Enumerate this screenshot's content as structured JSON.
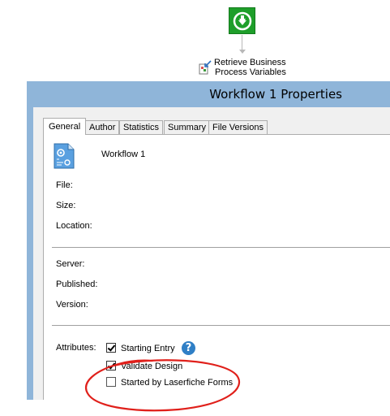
{
  "canvas": {
    "activity_label_line1": "Retrieve Business",
    "activity_label_line2": "Process Variables"
  },
  "window": {
    "title": "Workflow 1 Properties"
  },
  "tabs": [
    {
      "label": "General",
      "active": true
    },
    {
      "label": "Author",
      "active": false
    },
    {
      "label": "Statistics",
      "active": false
    },
    {
      "label": "Summary",
      "active": false
    },
    {
      "label": "File Versions",
      "active": false
    }
  ],
  "general": {
    "workflow_name": "Workflow 1",
    "file_label": "File:",
    "size_label": "Size:",
    "location_label": "Location:",
    "server_label": "Server:",
    "published_label": "Published:",
    "version_label": "Version:",
    "attributes_label": "Attributes:",
    "attributes": [
      {
        "label": "Starting Entry",
        "checked": true
      },
      {
        "label": "Validate Design",
        "checked": true
      },
      {
        "label": "Started by Laserfiche Forms",
        "checked": false
      }
    ]
  },
  "icons": {
    "start_node": "start-arrow-down-icon",
    "activity": "retrieve-variables-icon",
    "document": "workflow-document-icon",
    "help": "help-icon"
  },
  "colors": {
    "start_node": "#1e9e2a",
    "title_bar": "#8fb5d9",
    "annotation": "#e0201b",
    "help_icon": "#2f7fc6"
  }
}
